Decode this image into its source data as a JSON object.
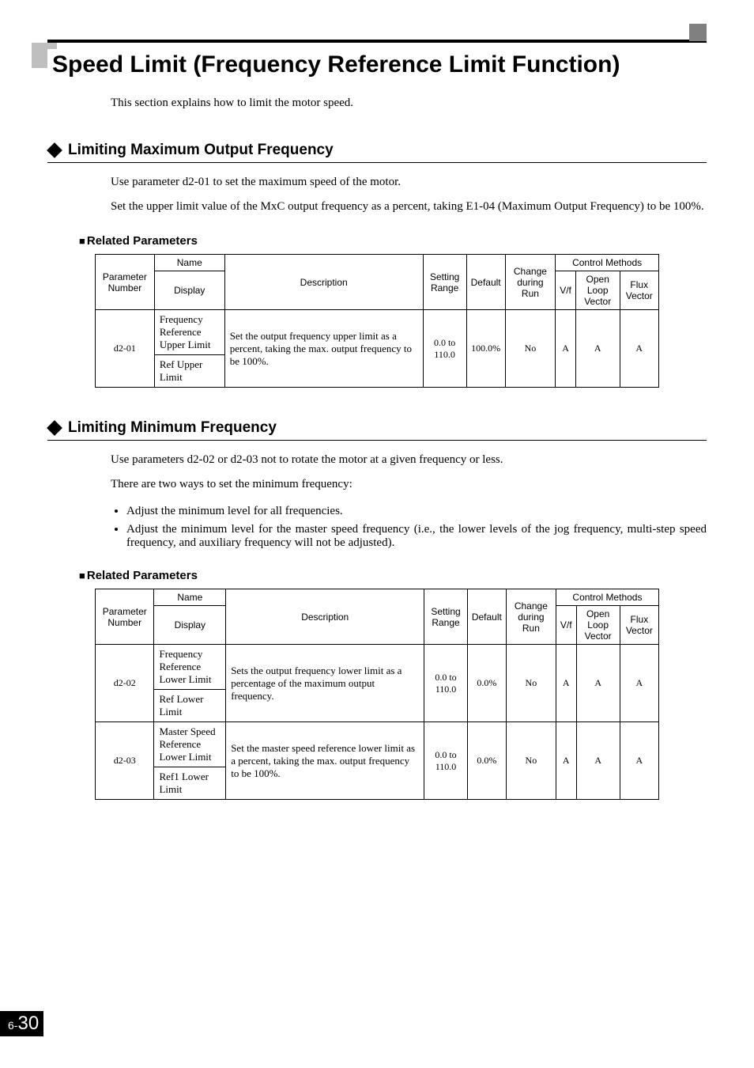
{
  "title": "Speed Limit (Frequency Reference Limit Function)",
  "intro": "This section explains how to limit the motor speed.",
  "section1": {
    "heading": "Limiting Maximum Output Frequency",
    "p1": "Use parameter d2-01 to set the maximum speed of the motor.",
    "p2": "Set the upper limit value of the MxC output frequency as a percent, taking E1-04 (Maximum Output Frequency) to be 100%.",
    "related_heading": "Related Parameters"
  },
  "table_headers": {
    "param_num": "Parameter Number",
    "name": "Name",
    "display": "Display",
    "description": "Description",
    "setting_range": "Setting Range",
    "default": "Default",
    "change": "Change during Run",
    "control_methods": "Control Methods",
    "vf": "V/f",
    "olv": "Open Loop Vector",
    "flux": "Flux Vector"
  },
  "section2": {
    "heading": "Limiting Minimum Frequency",
    "p1": "Use parameters d2-02 or d2-03 not to rotate the motor at a given frequency or less.",
    "p2": "There are two ways to set the minimum frequency:",
    "b1": "Adjust the minimum level for all frequencies.",
    "b2": "Adjust the minimum level for the master speed frequency (i.e., the lower levels of the jog frequency, multi-step speed frequency, and auxiliary frequency will not be adjusted).",
    "related_heading": "Related Parameters"
  },
  "page_number": {
    "chapter": "6",
    "sep": "-",
    "page": "30"
  },
  "chart_data": [
    {
      "type": "table",
      "title": "Related Parameters (Limiting Maximum Output Frequency)",
      "columns": [
        "Parameter Number",
        "Name",
        "Display",
        "Description",
        "Setting Range",
        "Default",
        "Change during Run",
        "V/f",
        "Open Loop Vector",
        "Flux Vector"
      ],
      "rows": [
        {
          "param": "d2-01",
          "name": "Frequency Reference Upper Limit",
          "display": "Ref Upper Limit",
          "description": "Set the output frequency upper limit as a percent, taking the max. output frequency to be 100%.",
          "setting_range": "0.0 to 110.0",
          "default": "100.0%",
          "change": "No",
          "vf": "A",
          "olv": "A",
          "flux": "A"
        }
      ]
    },
    {
      "type": "table",
      "title": "Related Parameters (Limiting Minimum Frequency)",
      "columns": [
        "Parameter Number",
        "Name",
        "Display",
        "Description",
        "Setting Range",
        "Default",
        "Change during Run",
        "V/f",
        "Open Loop Vector",
        "Flux Vector"
      ],
      "rows": [
        {
          "param": "d2-02",
          "name": "Frequency Reference Lower Limit",
          "display": "Ref Lower Limit",
          "description": "Sets the output frequency lower limit as a percentage of the maximum output frequency.",
          "setting_range": "0.0 to 110.0",
          "default": "0.0%",
          "change": "No",
          "vf": "A",
          "olv": "A",
          "flux": "A"
        },
        {
          "param": "d2-03",
          "name": "Master Speed Reference Lower Limit",
          "display": "Ref1 Lower Limit",
          "description": "Set the master speed reference lower limit as a percent, taking the max. output frequency to be 100%.",
          "setting_range": "0.0 to 110.0",
          "default": "0.0%",
          "change": "No",
          "vf": "A",
          "olv": "A",
          "flux": "A"
        }
      ]
    }
  ]
}
